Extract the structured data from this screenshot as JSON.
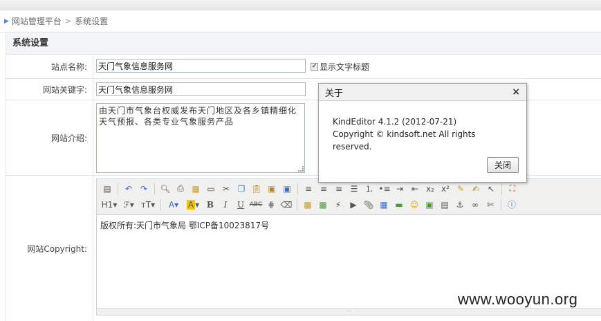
{
  "breadcrumb": {
    "root": "网站管理平台",
    "current": "系统设置"
  },
  "panel": {
    "title": "系统设置"
  },
  "form": {
    "site_name": {
      "label": "站点名称:",
      "value": "天门气象信息服务网"
    },
    "show_title_checkbox": {
      "label": "显示文字标题",
      "checked": true
    },
    "keywords": {
      "label": "网站关键字:",
      "value": "天门气象信息服务网"
    },
    "intro": {
      "label": "网站介绍:",
      "value": "由天门市气象台权威发布天门地区及各乡镇精细化天气预报、各类专业气象服务产品"
    },
    "copyright": {
      "label": "网站Copyright:",
      "value": "版权所有:天门市气象局 鄂ICP备10023817号"
    }
  },
  "toolbar": {
    "row1": [
      "source-icon",
      "undo-icon",
      "redo-icon",
      "preview-icon",
      "print-icon",
      "template-icon",
      "code-icon",
      "cut-icon",
      "copy-icon",
      "paste-icon",
      "paste-text-icon",
      "paste-word-icon",
      "justify-left-icon",
      "justify-center-icon",
      "justify-right-icon",
      "justify-full-icon",
      "ordered-list-icon",
      "unordered-list-icon",
      "indent-icon",
      "outdent-icon",
      "subscript-icon",
      "superscript-icon",
      "clear-html-icon",
      "quick-format-icon",
      "select-all-icon",
      "fullscreen-icon"
    ],
    "row2": [
      "heading-icon",
      "font-name-icon",
      "font-size-icon",
      "fore-color-icon",
      "hilite-color-icon",
      "bold-icon",
      "italic-icon",
      "underline-icon",
      "strikethrough-icon",
      "line-height-icon",
      "remove-format-icon",
      "image-icon",
      "multi-image-icon",
      "flash-icon",
      "media-icon",
      "insert-file-icon",
      "table-icon",
      "hr-icon",
      "emoticons-icon",
      "baidu-map-icon",
      "page-break-icon",
      "anchor-icon",
      "link-icon",
      "unlink-icon",
      "about-icon"
    ]
  },
  "dialog": {
    "title": "关于",
    "line1": "KindEditor 4.1.2 (2012-07-21)",
    "line2": "Copyright © kindsoft.net All rights reserved.",
    "close_button": "关闭"
  },
  "watermark": "www.wooyun.org"
}
